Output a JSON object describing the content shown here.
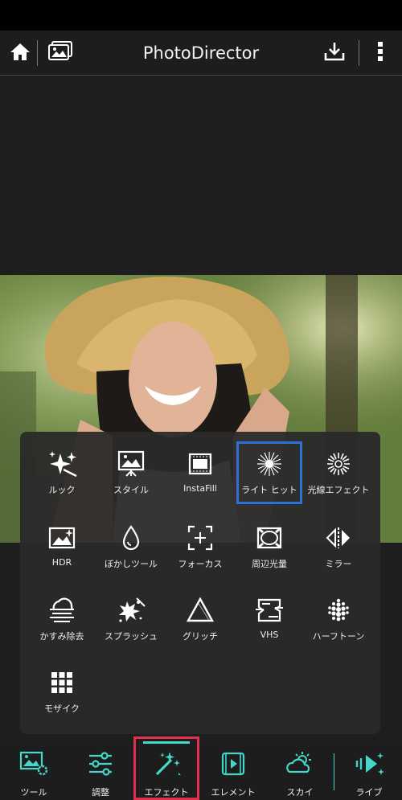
{
  "colors": {
    "accent": "#43d8c9",
    "selection": "#2f6fd8",
    "highlight": "#e0304e"
  },
  "header": {
    "title": "PhotoDirector",
    "icons": [
      "home-icon",
      "gallery-icon",
      "download-icon",
      "more-vertical-icon"
    ]
  },
  "effects": [
    {
      "label": "ルック",
      "icon": "sparkles-icon"
    },
    {
      "label": "スタイル",
      "icon": "style-icon"
    },
    {
      "label": "InstaFill",
      "icon": "instafill-icon"
    },
    {
      "label": "ライト ヒット",
      "icon": "light-hit-icon",
      "selected": true
    },
    {
      "label": "光線エフェクト",
      "icon": "ray-effect-icon"
    },
    {
      "label": "HDR",
      "icon": "hdr-icon"
    },
    {
      "label": "ぼかしツール",
      "icon": "blur-drop-icon"
    },
    {
      "label": "フォーカス",
      "icon": "focus-icon"
    },
    {
      "label": "周辺光量",
      "icon": "vignette-icon"
    },
    {
      "label": "ミラー",
      "icon": "mirror-icon"
    },
    {
      "label": "かすみ除去",
      "icon": "dehaze-icon"
    },
    {
      "label": "スプラッシュ",
      "icon": "splash-icon"
    },
    {
      "label": "グリッチ",
      "icon": "glitch-icon"
    },
    {
      "label": "VHS",
      "icon": "vhs-icon"
    },
    {
      "label": "ハーフトーン",
      "icon": "halftone-icon"
    },
    {
      "label": "モザイク",
      "icon": "mosaic-icon"
    }
  ],
  "tabs": [
    {
      "label": "ツール",
      "icon": "tools-icon"
    },
    {
      "label": "調整",
      "icon": "adjust-sliders-icon"
    },
    {
      "label": "エフェクト",
      "icon": "magic-wand-icon",
      "active": true
    },
    {
      "label": "エレメント",
      "icon": "element-icon"
    },
    {
      "label": "スカイ",
      "icon": "sky-icon"
    },
    {
      "label": "ライブ",
      "icon": "live-icon"
    }
  ]
}
